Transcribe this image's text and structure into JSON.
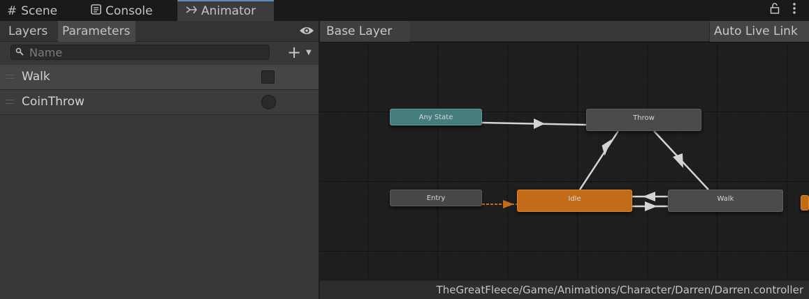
{
  "tabs": [
    {
      "label": "Scene",
      "icon": "grid-icon"
    },
    {
      "label": "Console",
      "icon": "console-icon"
    },
    {
      "label": "Animator",
      "icon": "animator-icon",
      "active": true
    }
  ],
  "window_icons": {
    "lock": "lock-icon",
    "menu": "kebab-menu-icon"
  },
  "left_panel": {
    "tabs": [
      {
        "label": "Layers"
      },
      {
        "label": "Parameters",
        "active": true
      }
    ],
    "eye_icon": "eye-icon",
    "search": {
      "value": "",
      "placeholder": "Name",
      "icon": "search-icon"
    },
    "add_button": "+",
    "parameters": [
      {
        "name": "Walk",
        "type": "bool",
        "value": false
      },
      {
        "name": "CoinThrow",
        "type": "trigger",
        "value": false
      }
    ]
  },
  "graph": {
    "breadcrumb": "Base Layer",
    "live_link_label": "Auto Live Link",
    "states": {
      "any_state": "Any State",
      "throw": "Throw",
      "entry": "Entry",
      "idle": "Idle",
      "walk": "Walk"
    },
    "default_state_color": "#c26b18",
    "any_state_color": "#457d7d",
    "transitions": [
      {
        "from": "Any State",
        "to": "Throw"
      },
      {
        "from": "Throw",
        "to": "Idle"
      },
      {
        "from": "Throw",
        "to": "Walk"
      },
      {
        "from": "Entry",
        "to": "Idle"
      },
      {
        "from": "Idle",
        "to": "Walk"
      },
      {
        "from": "Walk",
        "to": "Idle"
      }
    ],
    "asset_path": "TheGreatFleece/Game/Animations/Character/Darren/Darren.controller"
  }
}
